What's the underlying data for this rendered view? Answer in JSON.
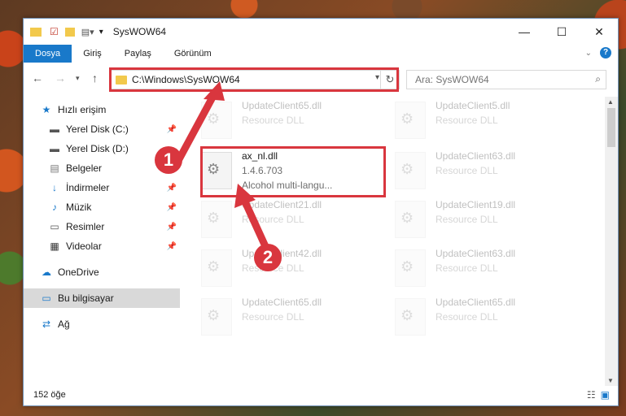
{
  "window": {
    "title": "SysWOW64"
  },
  "ribbon": {
    "tabs": [
      "Dosya",
      "Giriş",
      "Paylaş",
      "Görünüm"
    ]
  },
  "address": {
    "path": "C:\\Windows\\SysWOW64"
  },
  "search": {
    "placeholder": "Ara: SysWOW64"
  },
  "sidebar": {
    "items": [
      {
        "label": "Hızlı erişim",
        "icon": "star-icon"
      },
      {
        "label": "Yerel Disk (C:)",
        "icon": "drive-icon",
        "pinned": true
      },
      {
        "label": "Yerel Disk (D:)",
        "icon": "drive-icon"
      },
      {
        "label": "Belgeler",
        "icon": "documents-icon"
      },
      {
        "label": "İndirmeler",
        "icon": "download-icon",
        "pinned": true
      },
      {
        "label": "Müzik",
        "icon": "music-icon",
        "pinned": true
      },
      {
        "label": "Resimler",
        "icon": "pictures-icon",
        "pinned": true
      },
      {
        "label": "Videolar",
        "icon": "videos-icon",
        "pinned": true
      },
      {
        "label": "OneDrive",
        "icon": "cloud-icon"
      },
      {
        "label": "Bu bilgisayar",
        "icon": "computer-icon"
      },
      {
        "label": "Ağ",
        "icon": "network-icon"
      }
    ]
  },
  "files": [
    {
      "name": "UpdateClient65.dll",
      "line2": "Resource DLL",
      "line3": ""
    },
    {
      "name": "UpdateClient5.dll",
      "line2": "Resource DLL",
      "line3": ""
    },
    {
      "name": "ax_nl.dll",
      "line2": "1.4.6.703",
      "line3": "Alcohol multi-langu..."
    },
    {
      "name": "UpdateClient63.dll",
      "line2": "Resource DLL",
      "line3": ""
    },
    {
      "name": "UpdateClient21.dll",
      "line2": "Resource DLL",
      "line3": ""
    },
    {
      "name": "UpdateClient19.dll",
      "line2": "Resource DLL",
      "line3": ""
    },
    {
      "name": "UpdateClient42.dll",
      "line2": "Resource DLL",
      "line3": ""
    },
    {
      "name": "UpdateClient63.dll",
      "line2": "Resource DLL",
      "line3": ""
    },
    {
      "name": "UpdateClient65.dll",
      "line2": "Resource DLL",
      "line3": ""
    },
    {
      "name": "UpdateClient65.dll",
      "line2": "Resource DLL",
      "line3": ""
    }
  ],
  "status": {
    "count": "152 öğe"
  },
  "annotations": {
    "one": "1",
    "two": "2",
    "color": "#d9363e"
  }
}
